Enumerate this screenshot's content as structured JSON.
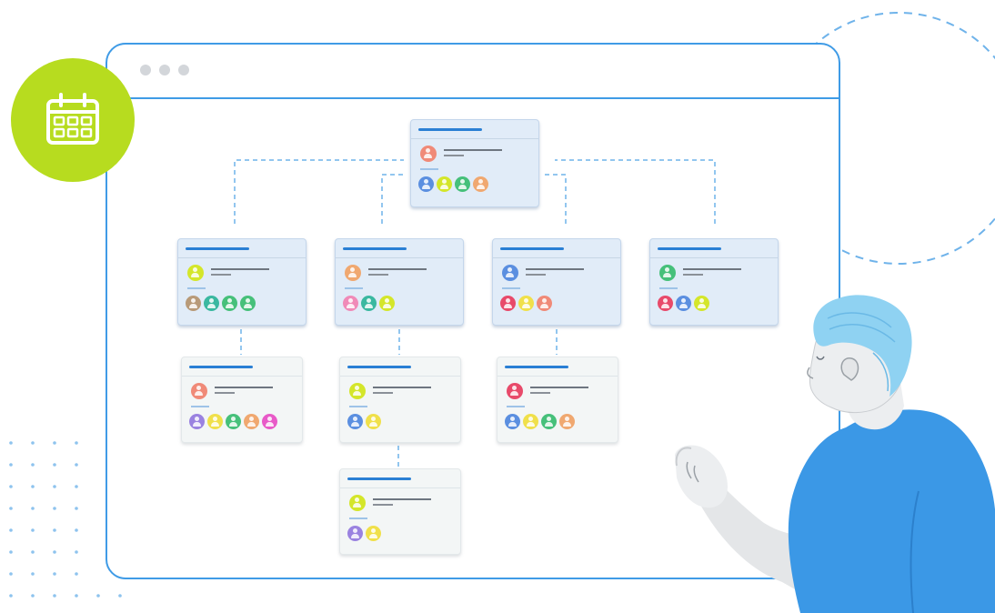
{
  "illustration": {
    "subject": "org-chart-in-browser-window",
    "icons": [
      "calendar-icon",
      "person-avatar-icon"
    ],
    "colors": {
      "window_border": "#3f9be6",
      "card_header_bar": "#2a7fd4",
      "card_fill": "#e1ecf8",
      "subcard_fill": "#f3f6f6",
      "badge": "#b7dc1f",
      "shirt": "#3b98e6",
      "hair": "#8fd2f2"
    },
    "avatar_palette": {
      "blue": "#5b8fe0",
      "lime": "#d4e62a",
      "green": "#46c07a",
      "orange": "#f0a870",
      "salmon": "#f08a78",
      "pink": "#f08ab8",
      "teal": "#3ab8a0",
      "tan": "#b89a78",
      "red": "#e84a6a",
      "purple": "#9a82e0",
      "magenta": "#e85ac8",
      "yellow": "#f0e04a"
    }
  }
}
